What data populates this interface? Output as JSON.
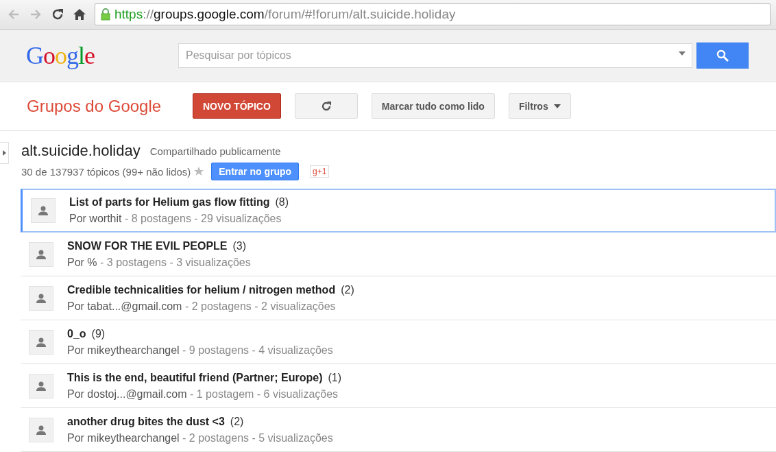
{
  "browser": {
    "url": {
      "scheme": "https",
      "separator": "://",
      "host": "groups.google.com",
      "path": "/forum/#!forum/alt.suicide.holiday"
    }
  },
  "header": {
    "logo": "Google",
    "search": {
      "placeholder": "Pesquisar por tópicos"
    }
  },
  "toolbar": {
    "title": "Grupos do Google",
    "buttons": [
      {
        "kind": "primary",
        "label": "NOVO TÓPICO"
      },
      {
        "kind": "refresh"
      },
      {
        "kind": "plain",
        "label": "Marcar tudo como lido"
      },
      {
        "kind": "dropdown",
        "label": "Filtros"
      }
    ]
  },
  "group": {
    "name": "alt.suicide.holiday",
    "visibility": "Compartilhado publicamente",
    "summary": "30 de 137937 tópicos (99+ não lidos)",
    "starred": false,
    "join": "Entrar no grupo",
    "plus_one": "g+1"
  },
  "topics": [
    {
      "title": "List of parts for Helium gas flow fitting",
      "count": "(8)",
      "author": "Por worthit",
      "stats": "- 8 postagens - 29 visualizações",
      "selected": true
    },
    {
      "title": "SNOW FOR THE EVIL PEOPLE",
      "count": "(3)",
      "author": "Por %",
      "stats": "- 3 postagens - 3 visualizações",
      "selected": false
    },
    {
      "title": "Credible technicalities for helium / nitrogen method",
      "count": "(2)",
      "author": "Por tabat...@gmail.com",
      "stats": "- 2 postagens - 2 visualizações",
      "selected": false
    },
    {
      "title": "0_o",
      "count": "(9)",
      "author": "Por mikeythearchangel",
      "stats": "- 9 postagens - 4 visualizações",
      "selected": false
    },
    {
      "title": "This is the end, beautiful friend (Partner; Europe)",
      "count": "(1)",
      "author": "Por dostoj...@gmail.com",
      "stats": "- 1 postagem - 6 visualizações",
      "selected": false
    },
    {
      "title": "another drug bites the dust <3",
      "count": "(2)",
      "author": "Por mikeythearchangel",
      "stats": "- 2 postagens - 5 visualizações",
      "selected": false
    }
  ]
}
